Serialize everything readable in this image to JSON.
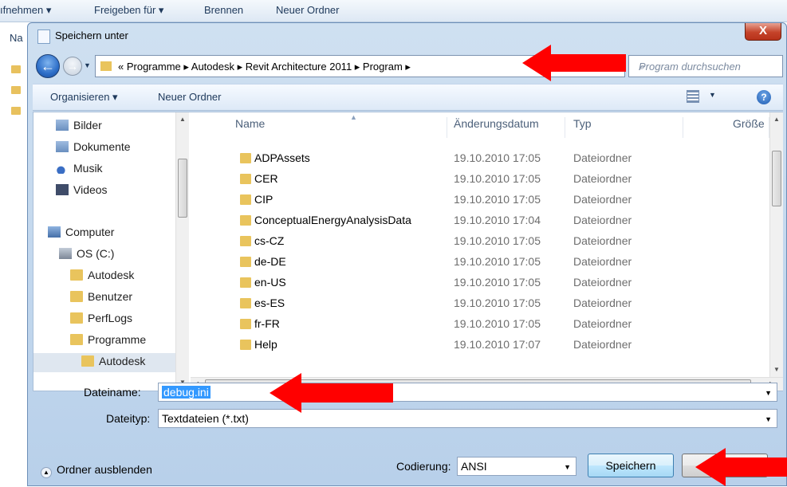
{
  "background_window": {
    "toolbar": [
      "ıfnehmen ▾",
      "Freigeben für ▾",
      "Brennen",
      "Neuer Ordner"
    ],
    "nav_label": "Na"
  },
  "dialog": {
    "title": "Speichern unter",
    "close_label": "X",
    "address_path": "« Programme ▸ Autodesk ▸ Revit Architecture 2011 ▸ Program ▸",
    "search_placeholder": "Program durchsuchen",
    "commands": {
      "organize": "Organisieren ▾",
      "new_folder": "Neuer Ordner"
    },
    "nav_items": [
      {
        "label": "Bilder",
        "icon": "pictures-library-icon"
      },
      {
        "label": "Dokumente",
        "icon": "documents-library-icon"
      },
      {
        "label": "Musik",
        "icon": "music-library-icon"
      },
      {
        "label": "Videos",
        "icon": "videos-library-icon"
      },
      {
        "label": "Computer",
        "icon": "computer-icon"
      },
      {
        "label": "OS (C:)",
        "icon": "drive-icon"
      },
      {
        "label": "Autodesk",
        "icon": "folder-icon"
      },
      {
        "label": "Benutzer",
        "icon": "folder-icon"
      },
      {
        "label": "PerfLogs",
        "icon": "folder-icon"
      },
      {
        "label": "Programme",
        "icon": "folder-icon"
      },
      {
        "label": "Autodesk",
        "icon": "folder-icon"
      }
    ],
    "columns": {
      "name": "Name",
      "date": "Änderungsdatum",
      "type": "Typ",
      "size": "Größe"
    },
    "files": [
      {
        "name": "ADPAssets",
        "date": "19.10.2010 17:05",
        "type": "Dateiordner"
      },
      {
        "name": "CER",
        "date": "19.10.2010 17:05",
        "type": "Dateiordner"
      },
      {
        "name": "CIP",
        "date": "19.10.2010 17:05",
        "type": "Dateiordner"
      },
      {
        "name": "ConceptualEnergyAnalysisData",
        "date": "19.10.2010 17:04",
        "type": "Dateiordner"
      },
      {
        "name": "cs-CZ",
        "date": "19.10.2010 17:05",
        "type": "Dateiordner"
      },
      {
        "name": "de-DE",
        "date": "19.10.2010 17:05",
        "type": "Dateiordner"
      },
      {
        "name": "en-US",
        "date": "19.10.2010 17:05",
        "type": "Dateiordner"
      },
      {
        "name": "es-ES",
        "date": "19.10.2010 17:05",
        "type": "Dateiordner"
      },
      {
        "name": "fr-FR",
        "date": "19.10.2010 17:05",
        "type": "Dateiordner"
      },
      {
        "name": "Help",
        "date": "19.10.2010 17:07",
        "type": "Dateiordner"
      }
    ],
    "filename_label": "Dateiname:",
    "filename_value": "debug.ini",
    "filetype_label": "Dateityp:",
    "filetype_value": "Textdateien (*.txt)",
    "hide_folders_label": "Ordner ausblenden",
    "encoding_label": "Codierung:",
    "encoding_value": "ANSI",
    "save_label": "Speichern",
    "cancel_label": "Ab"
  },
  "colors": {
    "annotation_arrow": "#ff0000",
    "selection": "#3399ff"
  }
}
